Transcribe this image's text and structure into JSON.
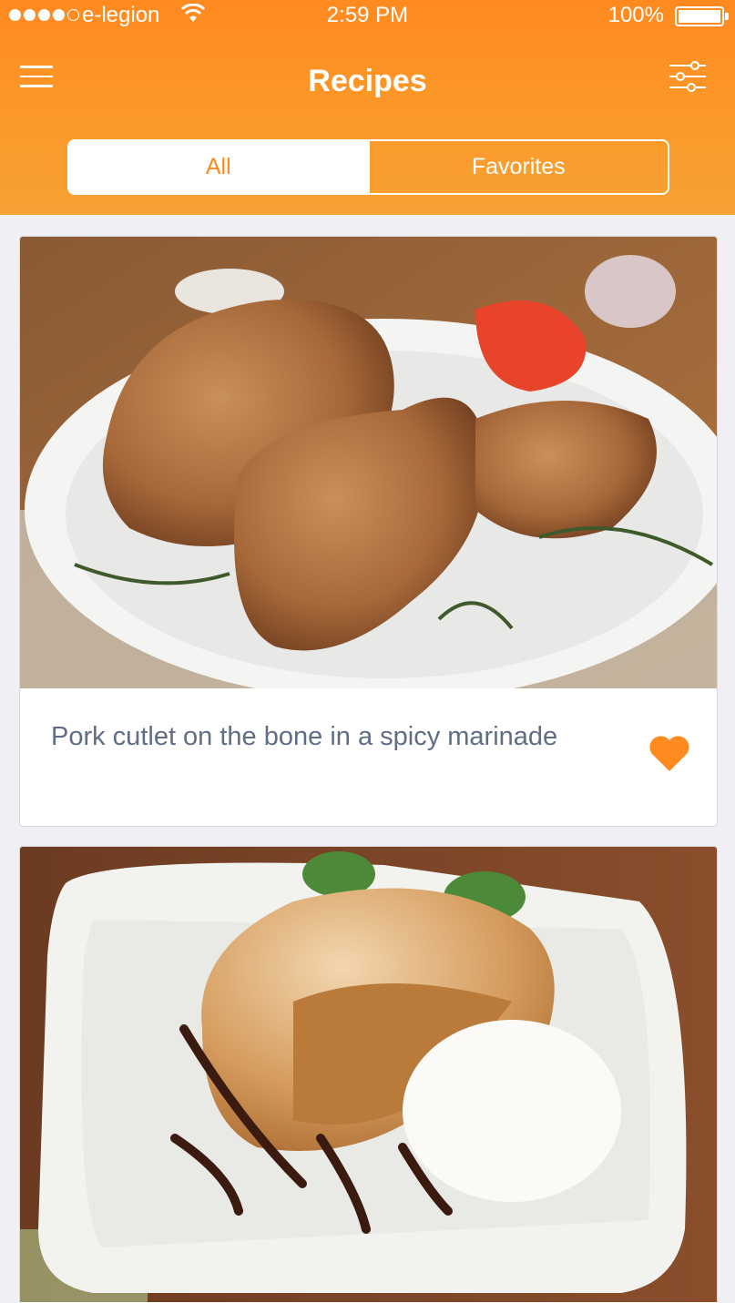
{
  "status_bar": {
    "carrier": "e-legion",
    "time": "2:59 PM",
    "battery": "100%"
  },
  "header": {
    "title": "Recipes",
    "menu_icon": "hamburger-menu-icon",
    "filter_icon": "sliders-filter-icon"
  },
  "segments": {
    "all_label": "All",
    "favorites_label": "Favorites",
    "selected": "All"
  },
  "recipes": [
    {
      "title": "Pork cutlet on the bone in a spicy marinade",
      "favorite": true,
      "photo": "grilled pork chops on white plate with rosemary and tomato"
    },
    {
      "title": "",
      "photo": "apple strudel with powdered sugar, vanilla ice cream and chocolate sauce"
    }
  ],
  "colors": {
    "accent": "#ff8a1f",
    "text_secondary": "#5f6d86",
    "background": "#efeff4"
  }
}
